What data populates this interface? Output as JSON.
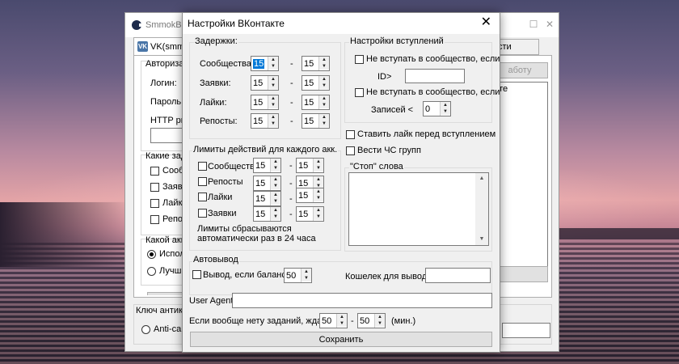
{
  "background_window": {
    "title": "SmmokBOT",
    "tab_label": "VK(smmok",
    "tab2_label": "сти",
    "auth_label": "Авторизаци",
    "login_label": "Логин:",
    "password_label": "Пароль:",
    "proxy_label": "HTTP prox",
    "tasks_label": "Какие зада",
    "task_items": [
      "Сообщ",
      "Заявк",
      "Лайки",
      "Репост"
    ],
    "account_label": "Какой акка",
    "account_options": [
      "Исполн",
      "Лучший"
    ],
    "account_selected": 0,
    "start_button": "аботу",
    "list_text": "йте",
    "captcha_label": "Ключ антика",
    "captcha_option": "Anti-capt"
  },
  "dialog": {
    "title": "Настройки ВКонтакте",
    "delays": {
      "label": "Задержки:",
      "rows": [
        {
          "label": "Сообщества:",
          "from": "15",
          "to": "15"
        },
        {
          "label": "Заявки:",
          "from": "15",
          "to": "15"
        },
        {
          "label": "Лайки:",
          "from": "15",
          "to": "15"
        },
        {
          "label": "Репосты:",
          "from": "15",
          "to": "15"
        }
      ],
      "separator": "-"
    },
    "join_settings": {
      "label": "Настройки вступлений",
      "no_join_if_label": "Не вступать в сообщество, если",
      "id_label": "ID>",
      "id_value": "",
      "no_join_posts_label": "Не вступать в сообщество, если",
      "posts_label": "Записей <",
      "posts_value": "0"
    },
    "like_before_join": "Ставить лайк перед вступлением",
    "blacklist_groups": "Вести ЧС групп",
    "stop_words": {
      "label": "\"Стоп\" слова",
      "value": ""
    },
    "limits": {
      "label": "Лимиты действий для каждого акк.",
      "rows": [
        {
          "label": "Сообщества",
          "from": "15",
          "to": "15"
        },
        {
          "label": "Репосты",
          "from": "15",
          "to": "15"
        },
        {
          "label": "Лайки",
          "from": "15",
          "to": "15"
        },
        {
          "label": "Заявки",
          "from": "15",
          "to": "15"
        }
      ],
      "note": "Лимиты сбрасываются автоматически раз в 24 часа"
    },
    "autowithdraw": {
      "label": "Автовывод",
      "balance_label": "Вывод, если баланс>",
      "balance_value": "50",
      "wallet_label": "Кошелек для вывода:",
      "wallet_value": ""
    },
    "user_agent": {
      "label": "User Agent:",
      "value": ""
    },
    "wait": {
      "label": "Если вообще нету заданий, ждать:",
      "from": "50",
      "to": "50",
      "unit": "(мин.)"
    },
    "save_button": "Сохранить"
  }
}
